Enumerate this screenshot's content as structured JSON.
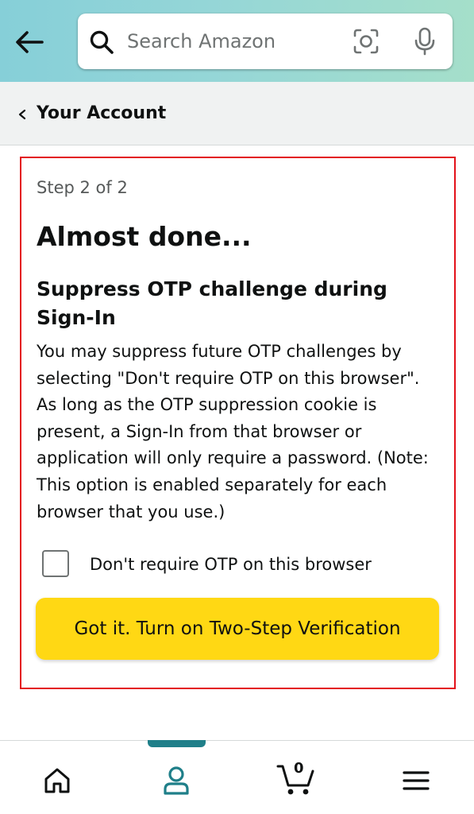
{
  "header": {
    "search_placeholder": "Search Amazon"
  },
  "breadcrumb": {
    "label": "Your Account"
  },
  "card": {
    "step": "Step 2 of 2",
    "title": "Almost done...",
    "subtitle": "Suppress OTP challenge during Sign-In",
    "description": "You may suppress future OTP challenges by selecting \"Don't require OTP on this browser\". As long as the OTP suppression cookie is present, a Sign-In from that browser or application will only require a password. (Note: This option is enabled separately for each browser that you use.)",
    "checkbox_label": "Don't require OTP on this browser",
    "checkbox_checked": false,
    "primary_button": "Got it. Turn on Two-Step Verification"
  },
  "bottom_nav": {
    "items": [
      "home-icon",
      "account-icon",
      "cart-icon",
      "menu-icon"
    ],
    "active": "account-icon",
    "cart_count": "0"
  },
  "colors": {
    "accent": "#1f7f89",
    "button": "#ffd814",
    "highlight_border": "#e3111a"
  }
}
